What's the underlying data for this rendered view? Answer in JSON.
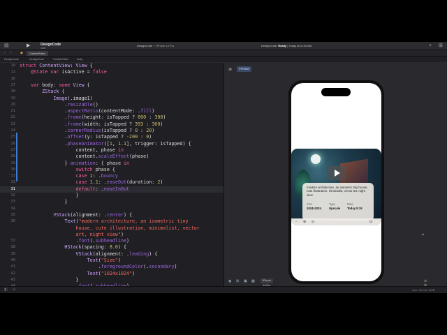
{
  "toolbar": {
    "project": "DesignCode",
    "branch": "main",
    "scheme_target": "DesignCode",
    "scheme_device": "iPhone 14 Pro",
    "status_app": "DesignCode:",
    "status_state": "Ready",
    "status_time": "| Today at 11:36 AM",
    "plus_glyph": "+",
    "sidebar_glyph": "▤",
    "play_glyph": "▶",
    "library_glyph": "⊞"
  },
  "tab": {
    "label": "ContentView"
  },
  "nav_arrows": "‹ ›",
  "breadcrumbs": [
    "DesignCode",
    "DesignCode",
    "ContentView",
    "body"
  ],
  "code": {
    "lines": [
      {
        "n": "10",
        "segs": [
          [
            "kw",
            "struct "
          ],
          [
            "ty",
            "ContentView"
          ],
          [
            "pl",
            ": "
          ],
          [
            "ty",
            "View"
          ],
          [
            "pl",
            " {"
          ]
        ]
      },
      {
        "n": "11",
        "segs": [
          [
            "pl",
            "    "
          ],
          [
            "kw",
            "@State var "
          ],
          [
            "pl",
            "isActive = "
          ],
          [
            "kw",
            "false"
          ]
        ]
      },
      {
        "n": "16",
        "segs": [
          [
            "pl",
            ""
          ]
        ]
      },
      {
        "n": "17",
        "segs": [
          [
            "pl",
            "    "
          ],
          [
            "kw",
            "var "
          ],
          [
            "pl",
            "body: "
          ],
          [
            "kw",
            "some "
          ],
          [
            "ty",
            "View"
          ],
          [
            "pl",
            " {"
          ]
        ]
      },
      {
        "n": "18",
        "segs": [
          [
            "pl",
            "        "
          ],
          [
            "ty",
            "ZStack"
          ],
          [
            "pl",
            " {"
          ]
        ]
      },
      {
        "n": "19",
        "segs": [
          [
            "pl",
            "            "
          ],
          [
            "ty",
            "Image"
          ],
          [
            "pl",
            "(.image1)"
          ]
        ]
      },
      {
        "n": "20",
        "segs": [
          [
            "pl",
            "                ."
          ],
          [
            "md",
            "resizable"
          ],
          [
            "pl",
            "()"
          ]
        ]
      },
      {
        "n": "21",
        "segs": [
          [
            "pl",
            "                ."
          ],
          [
            "md",
            "aspectRatio"
          ],
          [
            "pl",
            "(contentMode: ."
          ],
          [
            "md",
            "fill"
          ],
          [
            "pl",
            ")"
          ]
        ]
      },
      {
        "n": "22",
        "segs": [
          [
            "pl",
            "                ."
          ],
          [
            "md",
            "frame"
          ],
          [
            "pl",
            "(height: isTapped ? "
          ],
          [
            "nu",
            "600"
          ],
          [
            "pl",
            " : "
          ],
          [
            "nu",
            "300"
          ],
          [
            "pl",
            ")"
          ]
        ]
      },
      {
        "n": "23",
        "segs": [
          [
            "pl",
            "                ."
          ],
          [
            "md",
            "frame"
          ],
          [
            "pl",
            "(width: isTapped ? "
          ],
          [
            "nu",
            "393"
          ],
          [
            "pl",
            " : "
          ],
          [
            "nu",
            "360"
          ],
          [
            "pl",
            ")"
          ]
        ]
      },
      {
        "n": "24",
        "segs": [
          [
            "pl",
            "                ."
          ],
          [
            "md",
            "cornerRadius"
          ],
          [
            "pl",
            "(isTapped ? "
          ],
          [
            "nu",
            "0"
          ],
          [
            "pl",
            " : "
          ],
          [
            "nu",
            "20"
          ],
          [
            "pl",
            ")"
          ]
        ]
      },
      {
        "n": "25",
        "segs": [
          [
            "pl",
            "                ."
          ],
          [
            "md",
            "offset"
          ],
          [
            "pl",
            "(y: isTapped ? "
          ],
          [
            "nu",
            "-200"
          ],
          [
            "pl",
            " : "
          ],
          [
            "nu",
            "0"
          ],
          [
            "pl",
            ")"
          ]
        ]
      },
      {
        "n": "26",
        "segs": [
          [
            "pl",
            "                ."
          ],
          [
            "md",
            "phaseAnimator"
          ],
          [
            "pl",
            "(["
          ],
          [
            "nu",
            "1"
          ],
          [
            "pl",
            ", "
          ],
          [
            "nu",
            "1.1"
          ],
          [
            "pl",
            "], trigger: isTapped) {"
          ]
        ]
      },
      {
        "n": "27",
        "segs": [
          [
            "pl",
            "                    content, phase "
          ],
          [
            "kw",
            "in"
          ]
        ]
      },
      {
        "n": "28",
        "segs": [
          [
            "pl",
            "                    content."
          ],
          [
            "md",
            "scaleEffect"
          ],
          [
            "pl",
            "(phase)"
          ]
        ]
      },
      {
        "n": "29",
        "segs": [
          [
            "pl",
            "                } "
          ],
          [
            "md",
            "animation"
          ],
          [
            "pl",
            ": { phase "
          ],
          [
            "kw",
            "in"
          ]
        ]
      },
      {
        "n": "30",
        "segs": [
          [
            "pl",
            "                    "
          ],
          [
            "kw",
            "switch "
          ],
          [
            "pl",
            "phase {"
          ]
        ]
      },
      {
        "n": "31",
        "segs": [
          [
            "pl",
            "                    "
          ],
          [
            "kw",
            "case "
          ],
          [
            "nu",
            "1"
          ],
          [
            "pl",
            ": ."
          ],
          [
            "md",
            "bouncy"
          ]
        ]
      },
      {
        "n": "31",
        "segs": [
          [
            "pl",
            "                    "
          ],
          [
            "kw",
            "case "
          ],
          [
            "nu",
            "1.1"
          ],
          [
            "pl",
            ": ."
          ],
          [
            "md",
            "easeOut"
          ],
          [
            "pl",
            "(duration: "
          ],
          [
            "nu",
            "2"
          ],
          [
            "pl",
            ")"
          ]
        ]
      },
      {
        "n": "31",
        "segs": [
          [
            "pl",
            "                    "
          ],
          [
            "kw",
            "default"
          ],
          [
            "pl",
            ": ."
          ],
          [
            "md",
            "easeInOut"
          ]
        ]
      },
      {
        "n": "32",
        "segs": [
          [
            "pl",
            "                    }"
          ]
        ]
      },
      {
        "n": "33",
        "segs": [
          [
            "pl",
            "                }"
          ]
        ]
      },
      {
        "n": "34",
        "segs": [
          [
            "pl",
            ""
          ]
        ]
      },
      {
        "n": "35",
        "segs": [
          [
            "pl",
            "            "
          ],
          [
            "ty",
            "VStack"
          ],
          [
            "pl",
            "(alignment: ."
          ],
          [
            "md",
            "center"
          ],
          [
            "pl",
            ") {"
          ]
        ]
      },
      {
        "n": "36",
        "segs": [
          [
            "pl",
            "                "
          ],
          [
            "ty",
            "Text"
          ],
          [
            "pl",
            "("
          ],
          [
            "st",
            "\"modern architecture, an isometric tiny"
          ]
        ]
      },
      {
        "n": "",
        "segs": [
          [
            "st",
            "                    house, cute illustration, minimalist, vector"
          ]
        ]
      },
      {
        "n": "",
        "segs": [
          [
            "st",
            "                    art, night view\""
          ],
          [
            "pl",
            ")"
          ]
        ]
      },
      {
        "n": "37",
        "segs": [
          [
            "pl",
            "                    ."
          ],
          [
            "md",
            "font"
          ],
          [
            "pl",
            "(."
          ],
          [
            "md",
            "subheadline"
          ],
          [
            "pl",
            ")"
          ]
        ]
      },
      {
        "n": "38",
        "segs": [
          [
            "pl",
            "                "
          ],
          [
            "ty",
            "HStack"
          ],
          [
            "pl",
            "(spacing: "
          ],
          [
            "nu",
            "8.0"
          ],
          [
            "pl",
            ") {"
          ]
        ]
      },
      {
        "n": "39",
        "segs": [
          [
            "pl",
            "                    "
          ],
          [
            "ty",
            "VStack"
          ],
          [
            "pl",
            "(alignment: ."
          ],
          [
            "md",
            "leading"
          ],
          [
            "pl",
            ") {"
          ]
        ]
      },
      {
        "n": "40",
        "segs": [
          [
            "pl",
            "                        "
          ],
          [
            "ty",
            "Text"
          ],
          [
            "pl",
            "("
          ],
          [
            "st",
            "\"Size\""
          ],
          [
            "pl",
            ")"
          ]
        ]
      },
      {
        "n": "41",
        "segs": [
          [
            "pl",
            "                            ."
          ],
          [
            "md",
            "foregroundColor"
          ],
          [
            "pl",
            "(."
          ],
          [
            "md",
            "secondary"
          ],
          [
            "pl",
            ")"
          ]
        ]
      },
      {
        "n": "42",
        "segs": [
          [
            "pl",
            "                        "
          ],
          [
            "ty",
            "Text"
          ],
          [
            "pl",
            "("
          ],
          [
            "st",
            "\"1024x1024\""
          ],
          [
            "pl",
            ")"
          ]
        ]
      },
      {
        "n": "43",
        "segs": [
          [
            "pl",
            "                    }"
          ]
        ]
      },
      {
        "n": "44",
        "segs": [
          [
            "pl",
            "                    ."
          ],
          [
            "md",
            "font"
          ],
          [
            "pl",
            "(."
          ],
          [
            "md",
            "subheadline"
          ],
          [
            "pl",
            ")"
          ]
        ]
      }
    ]
  },
  "canvas": {
    "preview_label": "Preview",
    "pin_glyph": "⊕",
    "card_text": "modern architecture, an isometric tiny house, cute illustration, minimalist, vector art, night view",
    "meta": [
      {
        "label": "Size",
        "value": "1024x1024"
      },
      {
        "label": "Type",
        "value": "Upscale"
      },
      {
        "label": "Date",
        "value": "Today 5:19"
      }
    ],
    "strip_icons": [
      "⋯",
      "⊕",
      "⊙",
      "⊡"
    ],
    "device_chip": "iPhone 14 Pro",
    "controls": [
      "◉",
      "⊞",
      "▣",
      "▦"
    ],
    "zoom_glyphs": "⊖ ⊕ ⊡ ⊞",
    "cursor_glyph": "⌖"
  },
  "statusbar": {
    "left": "◧ ⊟",
    "position": "Line: 31  Col: 60  ⊞"
  },
  "colors": {
    "editor_bg": "#1f1f24",
    "keyword": "#fc5fa3",
    "type": "#d0a8ff",
    "string": "#fc6a5d",
    "number": "#d0bf69",
    "method": "#a167e6",
    "accent": "#3d7bd6"
  }
}
